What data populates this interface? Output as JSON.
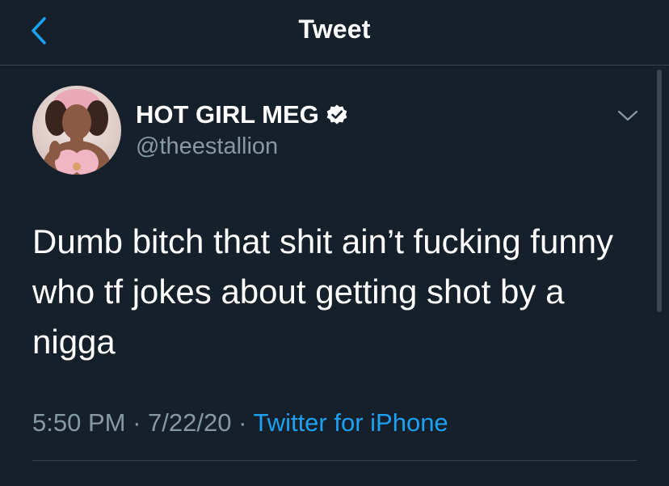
{
  "header": {
    "title": "Tweet",
    "back_icon": "chevron-left-icon",
    "accent": "#1da1f2"
  },
  "tweet": {
    "author_name": "HOT GIRL MEG",
    "handle": "@theestallion",
    "verified_icon": "verified-badge-icon",
    "text": "Dumb bitch that shit ain’t fucking funny who tf jokes about getting shot by a nigga",
    "time": "5:50 PM",
    "separator": " · ",
    "date": "7/22/20",
    "source": "Twitter for iPhone",
    "menu_icon": "chevron-down-icon"
  },
  "colors": {
    "background": "#15202b",
    "secondary_text": "#8899a6",
    "divider": "#38444d",
    "link": "#1da1f2"
  }
}
